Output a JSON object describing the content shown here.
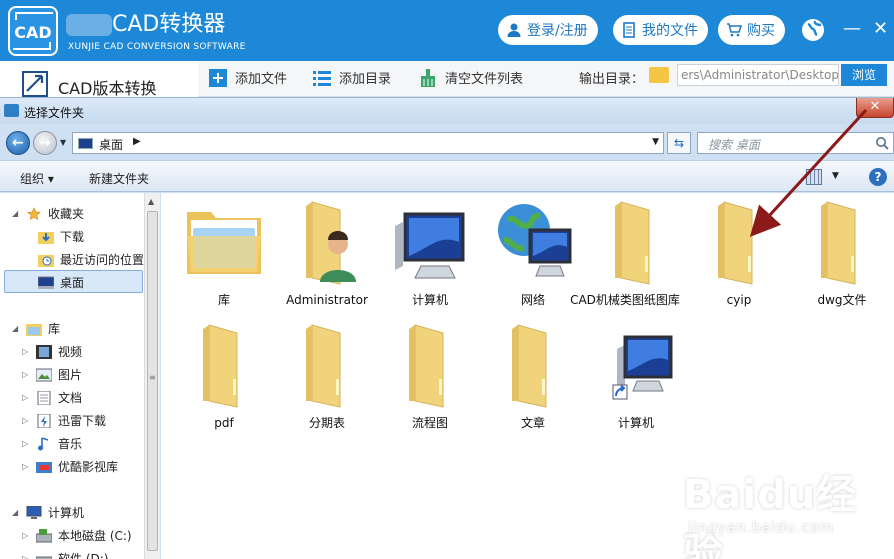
{
  "app": {
    "title": "CAD转换器",
    "subtitle": "XUNJIE CAD CONVERSION SOFTWARE",
    "logo_text": "CAD",
    "login": "登录/注册",
    "my_files": "我的文件",
    "buy": "购买",
    "side_tab": "CAD版本转换",
    "toolbar": {
      "add_file": "添加文件",
      "add_dir": "添加目录",
      "clear_list": "清空文件列表",
      "output_dir_label": "输出目录：",
      "output_path": "ers\\Administrator\\Desktop",
      "browse": "浏览"
    },
    "colors": {
      "header": "#1e88d8"
    }
  },
  "dialog": {
    "title": "选择文件夹",
    "address": "桌面",
    "search_placeholder": "搜索 桌面",
    "organize": "组织 ▾",
    "new_folder": "新建文件夹",
    "nav": [
      {
        "label": "收藏夹",
        "icon": "star-icon"
      },
      {
        "label": "下载",
        "icon": "download-folder-icon"
      },
      {
        "label": "最近访问的位置",
        "icon": "recent-places-icon"
      },
      {
        "label": "桌面",
        "icon": "desktop-icon"
      },
      {
        "label": "库",
        "icon": "library-icon"
      },
      {
        "label": "视频",
        "icon": "video-icon"
      },
      {
        "label": "图片",
        "icon": "pictures-icon"
      },
      {
        "label": "文档",
        "icon": "documents-icon"
      },
      {
        "label": "迅雷下载",
        "icon": "thunder-download-icon"
      },
      {
        "label": "音乐",
        "icon": "music-icon"
      },
      {
        "label": "优酷影视库",
        "icon": "youku-icon"
      },
      {
        "label": "计算机",
        "icon": "computer-icon"
      },
      {
        "label": "本地磁盘 (C:)",
        "icon": "disk-icon"
      },
      {
        "label": "软件 (D:)",
        "icon": "disk-icon"
      }
    ],
    "items": [
      {
        "label": "库",
        "icon": "library-folder-icon"
      },
      {
        "label": "Administrator",
        "icon": "user-folder-icon"
      },
      {
        "label": "计算机",
        "icon": "computer-icon"
      },
      {
        "label": "网络",
        "icon": "network-icon"
      },
      {
        "label": "CAD机械类图纸图库",
        "icon": "folder-icon"
      },
      {
        "label": "cyip",
        "icon": "folder-icon"
      },
      {
        "label": "dwg文件",
        "icon": "folder-icon"
      },
      {
        "label": "pdf",
        "icon": "folder-icon"
      },
      {
        "label": "分期表",
        "icon": "folder-icon"
      },
      {
        "label": "流程图",
        "icon": "folder-icon"
      },
      {
        "label": "文章",
        "icon": "folder-icon"
      },
      {
        "label": "计算机",
        "icon": "computer-shortcut-icon"
      }
    ]
  },
  "watermark": {
    "text": "Baidu经验",
    "sub": "jingyan.baidu.com"
  }
}
